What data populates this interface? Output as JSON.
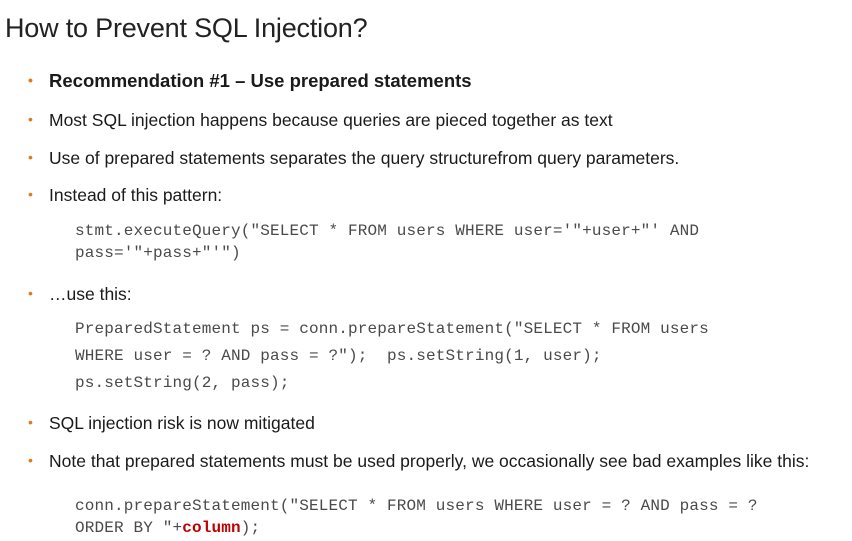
{
  "title": "How to Prevent SQL Injection?",
  "bullets": {
    "b1": "Recommendation #1 – Use prepared statements",
    "b2": "Most SQL injection happens because queries are pieced together as text",
    "b3": "Use of prepared statements separates the query structurefrom query parameters.",
    "b4": "Instead of this pattern:",
    "b5": "…use this:",
    "b6": "SQL injection risk is now mitigated",
    "b7": "Note that prepared statements must be used properly, we occasionally see bad examples like this:"
  },
  "bullet_symbol": "•",
  "code": {
    "bad_line1": "stmt.executeQuery(\"SELECT * FROM users WHERE user='\"+user+\"' AND",
    "bad_line2": "pass='\"+pass+\"'\")",
    "good_line1": "PreparedStatement ps = conn.prepareStatement(\"SELECT * FROM users",
    "good_line2": "WHERE user = ? AND pass = ?\");  ps.setString(1, user);",
    "good_line3": "ps.setString(2, pass);",
    "misuse_line1": "conn.prepareStatement(\"SELECT * FROM users WHERE user = ? AND pass = ?",
    "misuse_line2_prefix": "ORDER BY \"+",
    "misuse_line2_highlight": "column",
    "misuse_line2_suffix": ");"
  },
  "colors": {
    "bullet_dot": "#e07a1f",
    "code_highlight": "#c00000"
  }
}
